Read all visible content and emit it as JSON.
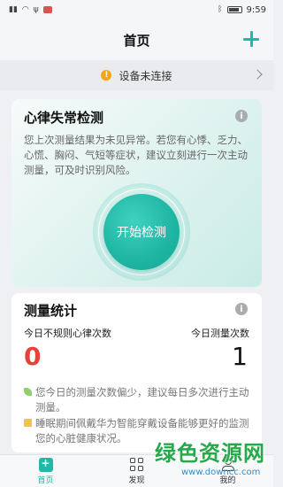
{
  "statusbar": {
    "time": "9:59",
    "battery_icon": "battery-icon",
    "bluetooth_icon": "bluetooth-icon"
  },
  "header": {
    "title": "首页",
    "add_icon": "plus-icon"
  },
  "device_banner": {
    "text": "设备未连接"
  },
  "arrhythmia_card": {
    "title": "心律失常检测",
    "description": "您上次测量结果为未见异常。若您有心悸、乏力、心慌、胸闷、气短等症状，建议立刻进行一次主动测量，可及时识别风险。",
    "start_button": "开始检测"
  },
  "stats_card": {
    "title": "测量统计",
    "irregular_label": "今日不规则心律次数",
    "irregular_value": "0",
    "measure_label": "今日测量次数",
    "measure_value": "1",
    "tip1": "您今日的测量次数偏少，建议每日多次进行主动测量。",
    "tip2": "睡眠期间佩戴华为智能穿戴设备能够更好的监测您的心脏健康状况。"
  },
  "bottom_nav": {
    "items": [
      {
        "label": "首页",
        "icon": "home-icon"
      },
      {
        "label": "发现",
        "icon": "grid-icon"
      },
      {
        "label": "我的",
        "icon": "user-icon"
      }
    ]
  },
  "watermark": {
    "text": "绿色资源网",
    "url": "www.downcc.com"
  },
  "colors": {
    "accent": "#20b8a6",
    "warning": "#f2a516",
    "alert_value": "#e8413c"
  }
}
